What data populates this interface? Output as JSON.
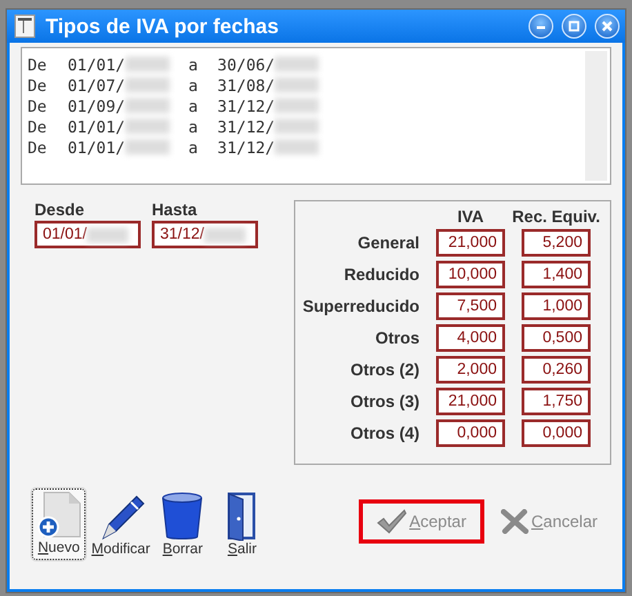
{
  "window": {
    "title": "Tipos de IVA por fechas"
  },
  "periods": [
    {
      "from_label": "De",
      "from": "01/01/",
      "to_label": "a",
      "to": "30/06/"
    },
    {
      "from_label": "De",
      "from": "01/07/",
      "to_label": "a",
      "to": "31/08/"
    },
    {
      "from_label": "De",
      "from": "01/09/",
      "to_label": "a",
      "to": "31/12/"
    },
    {
      "from_label": "De",
      "from": "01/01/",
      "to_label": "a",
      "to": "31/12/"
    },
    {
      "from_label": "De",
      "from": "01/01/",
      "to_label": "a",
      "to": "31/12/"
    }
  ],
  "date_fields": [
    {
      "label": "Desde",
      "value": "01/01/"
    },
    {
      "label": "Hasta",
      "value": "31/12/"
    }
  ],
  "rates": {
    "columns": [
      "IVA",
      "Rec. Equiv."
    ],
    "rows": [
      {
        "label": "General",
        "iva": "21,000",
        "rec": "5,200"
      },
      {
        "label": "Reducido",
        "iva": "10,000",
        "rec": "1,400"
      },
      {
        "label": "Superreducido",
        "iva": "7,500",
        "rec": "1,000"
      },
      {
        "label": "Otros",
        "iva": "4,000",
        "rec": "0,500"
      },
      {
        "label": "Otros (2)",
        "iva": "2,000",
        "rec": "0,260"
      },
      {
        "label": "Otros (3)",
        "iva": "21,000",
        "rec": "1,750"
      },
      {
        "label": "Otros (4)",
        "iva": "0,000",
        "rec": "0,000"
      }
    ]
  },
  "toolbar": [
    {
      "kind": "new",
      "label": "Nuevo",
      "focused": true
    },
    {
      "kind": "edit",
      "label": "Modificar",
      "focused": false
    },
    {
      "kind": "delete",
      "label": "Borrar",
      "focused": false
    },
    {
      "kind": "exit",
      "label": "Salir",
      "focused": false
    }
  ],
  "actions": [
    {
      "kind": "ok",
      "label": "Aceptar",
      "disabled": true,
      "highlighted": true
    },
    {
      "kind": "cancel",
      "label": "Cancelar",
      "disabled": true,
      "highlighted": false
    }
  ]
}
